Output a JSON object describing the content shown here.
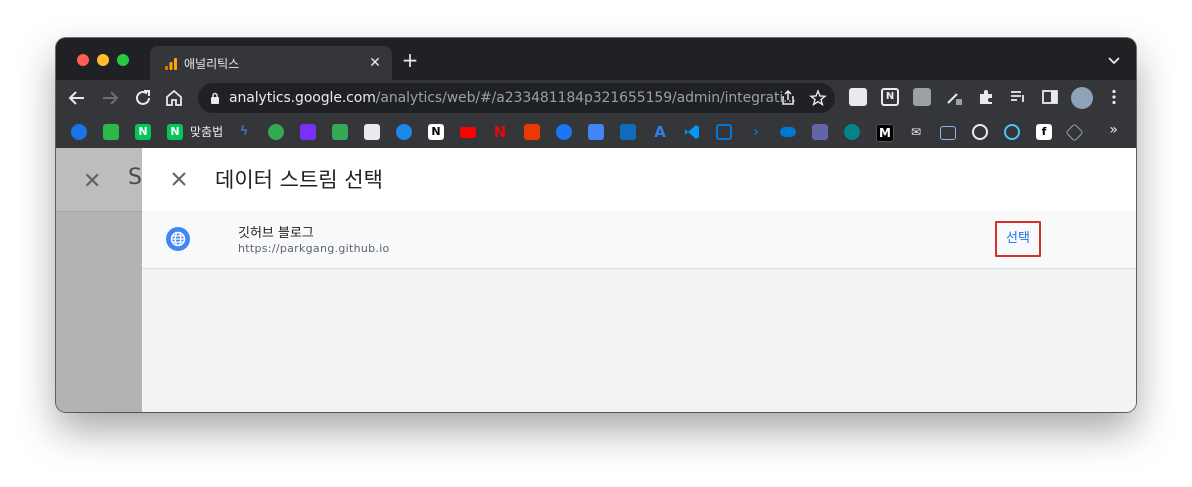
{
  "browser": {
    "tab": {
      "title": "애널리틱스"
    },
    "omnibox": {
      "host": "analytics.google.com",
      "path": "/analytics/web/#/a233481184p321655159/admin/integrati..."
    },
    "bookmarks": {
      "named_label": "맞춤법",
      "more": "»"
    }
  },
  "behind_panel": {
    "partial_title": "S"
  },
  "dialog": {
    "title": "데이터 스트림 선택",
    "streams": [
      {
        "name": "깃허브 블로그",
        "url": "https://parkgang.github.io",
        "action_label": "선택"
      }
    ]
  },
  "colors": {
    "link_blue": "#1a73e8",
    "highlight_red": "#d93025",
    "globe_blue": "#4285f4"
  }
}
